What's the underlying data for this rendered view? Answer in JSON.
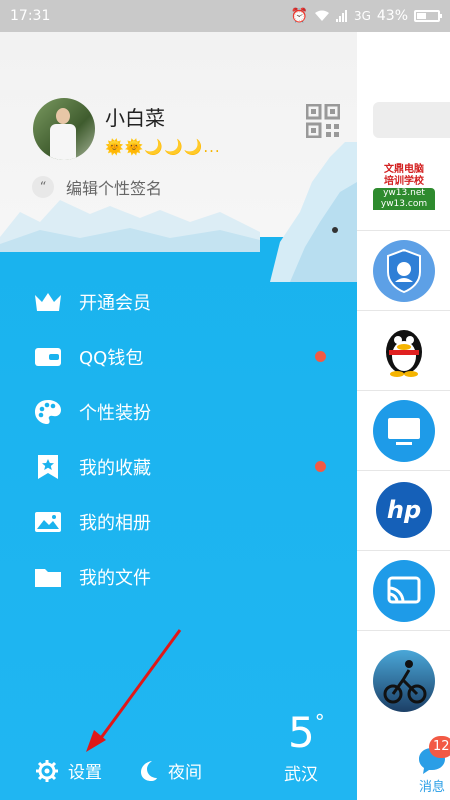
{
  "status_bar": {
    "time": "17:31",
    "network": "3G",
    "battery_percent": "43%",
    "battery_level": 0.43
  },
  "profile": {
    "username": "小白菜",
    "level_icons": "🌞🌞🌙🌙🌙...",
    "signature_placeholder": "编辑个性签名"
  },
  "menu": {
    "items": [
      {
        "label": "开通会员",
        "icon": "crown-icon",
        "badge": false
      },
      {
        "label": "QQ钱包",
        "icon": "wallet-icon",
        "badge": true
      },
      {
        "label": "个性装扮",
        "icon": "palette-icon",
        "badge": false
      },
      {
        "label": "我的收藏",
        "icon": "favorite-star-icon",
        "badge": true
      },
      {
        "label": "我的相册",
        "icon": "photo-album-icon",
        "badge": false
      },
      {
        "label": "我的文件",
        "icon": "folder-icon",
        "badge": false
      }
    ]
  },
  "bottom": {
    "settings_label": "设置",
    "night_label": "夜间",
    "temperature": "5",
    "temperature_unit": "°",
    "city": "武汉"
  },
  "conversations": {
    "first_avatar_text_line1": "文鼎电脑",
    "first_avatar_text_line2": "培训学校",
    "first_avatar_text_line3": "yw13.net",
    "first_avatar_text_line4": "yw13.com"
  },
  "tabbar": {
    "messages_label": "消息",
    "messages_badge": "12"
  },
  "colors": {
    "drawer_blue": "#1ab3ee",
    "badge_red": "#f25a45",
    "accent_blue": "#2a9ee6"
  }
}
